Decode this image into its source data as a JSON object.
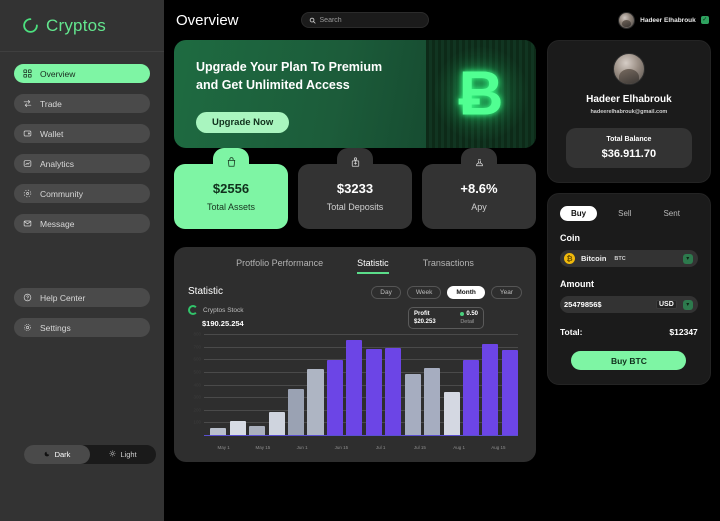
{
  "brand": {
    "name": "Cryptos",
    "logo_icon": "circle-loader-icon"
  },
  "sidebar": {
    "items": [
      {
        "label": "Overview",
        "icon": "grid-icon",
        "active": true
      },
      {
        "label": "Trade",
        "icon": "exchange-icon",
        "active": false
      },
      {
        "label": "Wallet",
        "icon": "wallet-icon",
        "active": false
      },
      {
        "label": "Analytics",
        "icon": "analytics-icon",
        "active": false
      },
      {
        "label": "Community",
        "icon": "community-icon",
        "active": false
      },
      {
        "label": "Message",
        "icon": "envelope-icon",
        "active": false
      }
    ],
    "bottom_items": [
      {
        "label": "Help Center",
        "icon": "question-circle-icon"
      },
      {
        "label": "Settings",
        "icon": "gear-icon"
      }
    ],
    "theme": {
      "dark_label": "Dark",
      "light_label": "Light",
      "dark_icon": "moon-icon",
      "light_icon": "sun-icon",
      "selected": "Dark"
    }
  },
  "header": {
    "title": "Overview",
    "search": {
      "placeholder": "Search",
      "value": "",
      "icon": "search-icon"
    },
    "user": {
      "name": "Hadeer Elhabrouk",
      "verified_icon": "verified-badge-icon",
      "avatar": "user-avatar"
    }
  },
  "promo": {
    "title_line1": "Upgrade Your Plan To Premium",
    "title_line2": "and  Get Unlimited Access",
    "button": "Upgrade Now",
    "art_symbol": "Ƀ",
    "art_name": "bitcoin-circuit-art"
  },
  "stats": [
    {
      "value": "$2556",
      "label": "Total Assets",
      "icon": "bag-icon",
      "accent": true
    },
    {
      "value": "$3233",
      "label": "Total Deposits",
      "icon": "deposit-icon",
      "accent": false
    },
    {
      "value": "+8.6%",
      "label": "Apy",
      "icon": "apy-bag-icon",
      "accent": false
    }
  ],
  "panel": {
    "tabs": [
      {
        "label": "Protfolio Performance",
        "active": false
      },
      {
        "label": "Statistic",
        "active": true
      },
      {
        "label": "Transactions",
        "active": false
      }
    ],
    "title": "Statistic",
    "legend_label": "Cryptos Stock",
    "legend_value": "$190.25.254",
    "ranges": [
      {
        "label": "Day",
        "selected": false
      },
      {
        "label": "Week",
        "selected": false
      },
      {
        "label": "Month",
        "selected": true
      },
      {
        "label": "Year",
        "selected": false
      }
    ],
    "tooltip": {
      "profit_label": "Profit",
      "profit_value": "$20.253",
      "change": "0.50",
      "detail_label": "Detail"
    }
  },
  "chart_data": {
    "type": "bar",
    "title": "Statistic",
    "xlabel": "",
    "ylabel": "",
    "grid": true,
    "legend": "Cryptos Stock",
    "categories": [
      "May 1",
      "",
      "May 15",
      "",
      "Jun 1",
      "",
      "Jun 15",
      "",
      "Jul 1",
      "",
      "Jul 15",
      "",
      "Aug 1",
      "",
      "Aug 15",
      ""
    ],
    "xtick_labels": [
      "May 1",
      "May 15",
      "Jun 1",
      "Jun 15",
      "Jul 1",
      "Jul 15",
      "Aug 1",
      "Aug 15"
    ],
    "ylim": [
      0,
      800
    ],
    "yticks": [
      100,
      200,
      300,
      400,
      500,
      600,
      700,
      800
    ],
    "colors": {
      "primary": "#6c45e6",
      "secondary": "#a6adc0",
      "light": "#d4d8e2"
    },
    "values": [
      60,
      120,
      80,
      190,
      370,
      530,
      600,
      760,
      690,
      700,
      490,
      540,
      350,
      600,
      730,
      680
    ],
    "bar_colors": [
      "#b9bfcc",
      "#d7dbe4",
      "#aab0bd",
      "#cfd4de",
      "#9aa2b3",
      "#aeb5c3",
      "#6c45e6",
      "#6c45e6",
      "#6c45e6",
      "#6c45e6",
      "#a6adc0",
      "#a6adc0",
      "#d4d8e2",
      "#6c45e6",
      "#6c45e6",
      "#6c45e6"
    ]
  },
  "profile_card": {
    "name": "Hadeer Elhabrouk",
    "email": "hadeerelhabrouk@gmail.com",
    "balance_label": "Total Balance",
    "balance_value": "$36.911.70"
  },
  "trade_card": {
    "tabs": [
      {
        "label": "Buy",
        "selected": true
      },
      {
        "label": "Sell",
        "selected": false
      },
      {
        "label": "Sent",
        "selected": false
      }
    ],
    "coin_label": "Coin",
    "coin": {
      "symbol_letter": "₿",
      "name": "Bitcoin",
      "ticker": "BTC"
    },
    "amount_label": "Amount",
    "amount_value": "25479856$",
    "currency": "USD",
    "total_label": "Total:",
    "total_value": "$12347",
    "buy_button": "Buy BTC"
  },
  "colors": {
    "accent_green": "#7ef5a4",
    "bar_purple": "#6c45e6",
    "sidebar_bg": "#333333",
    "panel_bg": "#2e2e2e",
    "card_bg": "#1b1b1b"
  }
}
